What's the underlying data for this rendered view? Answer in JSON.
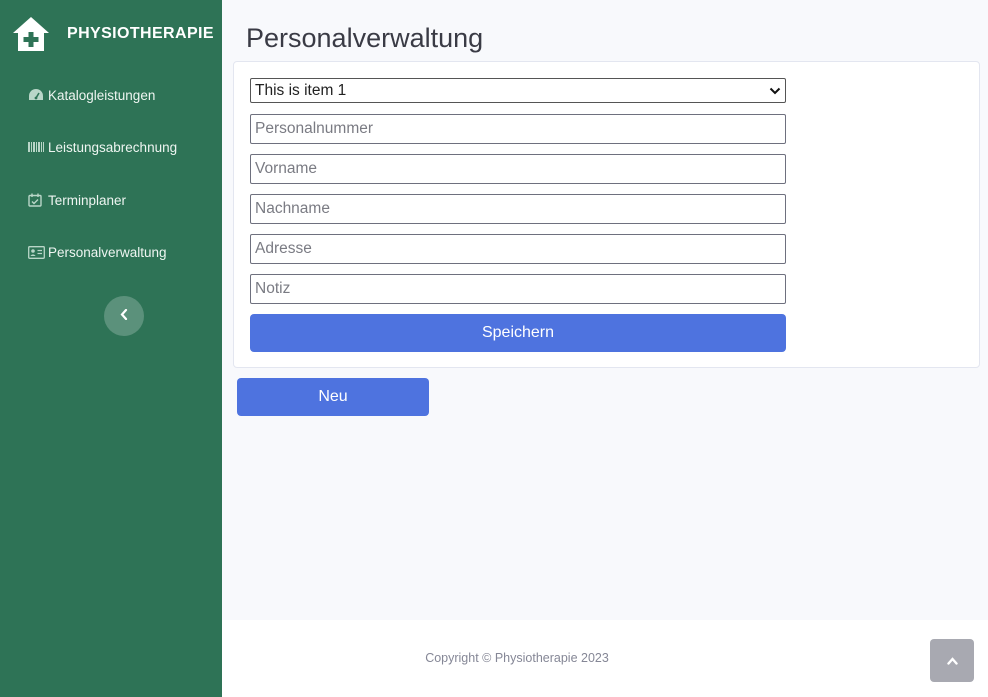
{
  "brand": {
    "name": "PHYSIOTHERAPIE",
    "icon": "hospital-house-icon"
  },
  "sidebar": {
    "items": [
      {
        "label": "Katalogleistungen",
        "icon": "tachometer-icon"
      },
      {
        "label": "Leistungsabrechnung",
        "icon": "barcode-icon"
      },
      {
        "label": "Terminplaner",
        "icon": "calendar-check-icon"
      },
      {
        "label": "Personalverwaltung",
        "icon": "id-card-icon"
      }
    ],
    "toggle_icon": "chevron-left-icon"
  },
  "page": {
    "title": "Personalverwaltung"
  },
  "form": {
    "select_value": "This is item 1",
    "fields": [
      {
        "placeholder": "Personalnummer",
        "value": ""
      },
      {
        "placeholder": "Vorname",
        "value": ""
      },
      {
        "placeholder": "Nachname",
        "value": ""
      },
      {
        "placeholder": "Adresse",
        "value": ""
      },
      {
        "placeholder": "Notiz",
        "value": ""
      }
    ],
    "save_label": "Speichern"
  },
  "actions": {
    "new_label": "Neu"
  },
  "footer": {
    "copyright": "Copyright © Physiotherapie 2023",
    "scroll_top_icon": "chevron-up-icon"
  },
  "colors": {
    "sidebar": "#2e7356",
    "primary": "#4e73df",
    "background": "#f8f9fc",
    "scroll_button": "#a8a9b1"
  }
}
